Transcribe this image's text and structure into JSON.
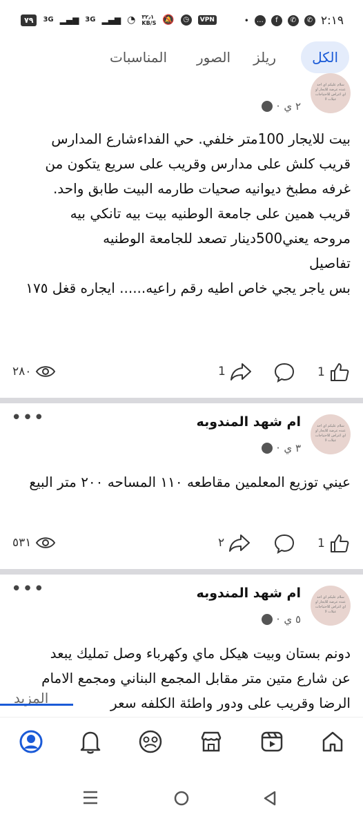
{
  "status_bar": {
    "battery": "٧٩",
    "signal1": "3G",
    "signal2": "3G",
    "speed_value": "٣٢٫١",
    "speed_unit": "KB/S",
    "vpn": "VPN",
    "time": "٢:١٩"
  },
  "tabs": [
    {
      "label": "الكل"
    },
    {
      "label": "ريلز"
    },
    {
      "label": "الصور"
    },
    {
      "label": "المناسبات"
    }
  ],
  "posts": [
    {
      "time": "٢ ي",
      "lines": [
        "بيت للايجار 100متر خلفي. حي الفداءشارع المدارس",
        "قريب كلش على مدارس وقريب على سريع يتكون من",
        "غرفه مطبخ ديوانيه صحيات طارمه البيت طابق واحد.",
        "قريب همين على جامعة الوطنيه بيت بيه تانكي بيه",
        "مروحه  يعني500دينار تصعد للجامعة الوطنيه",
        "تفاصيل",
        "بس ياجر يجي خاص اطيه رقم راعيه...... ايجاره قغل ١٧٥"
      ],
      "likes": "1",
      "comments": "",
      "shares": "1",
      "views": "٢٨٠"
    },
    {
      "author": "ام شهد المندوبه",
      "time": "٣ ي",
      "lines": [
        "عيني توزيع المعلمين مقاطعه ١١٠ المساحه ٢٠٠ متر  البيع"
      ],
      "likes": "1",
      "comments": "",
      "shares": "٢",
      "views": "٥٣١"
    },
    {
      "author": "ام شهد المندوبه",
      "time": "٥ ي",
      "lines": [
        "دونم بستان وبيت هيكل ماي وكهرباء وصل تمليك يبعد",
        "عن شارع متين متر مقابل المجمع البناني ومجمع الامام",
        "الرضا وقريب على ودور واطئة الكلفه سعر 19وب..."
      ],
      "more": "المزيد"
    }
  ],
  "avatar_text": "سلام عليكم اي احد عنده عرضة للايجار او اي اغراض للاحتياجات عيلات لا"
}
